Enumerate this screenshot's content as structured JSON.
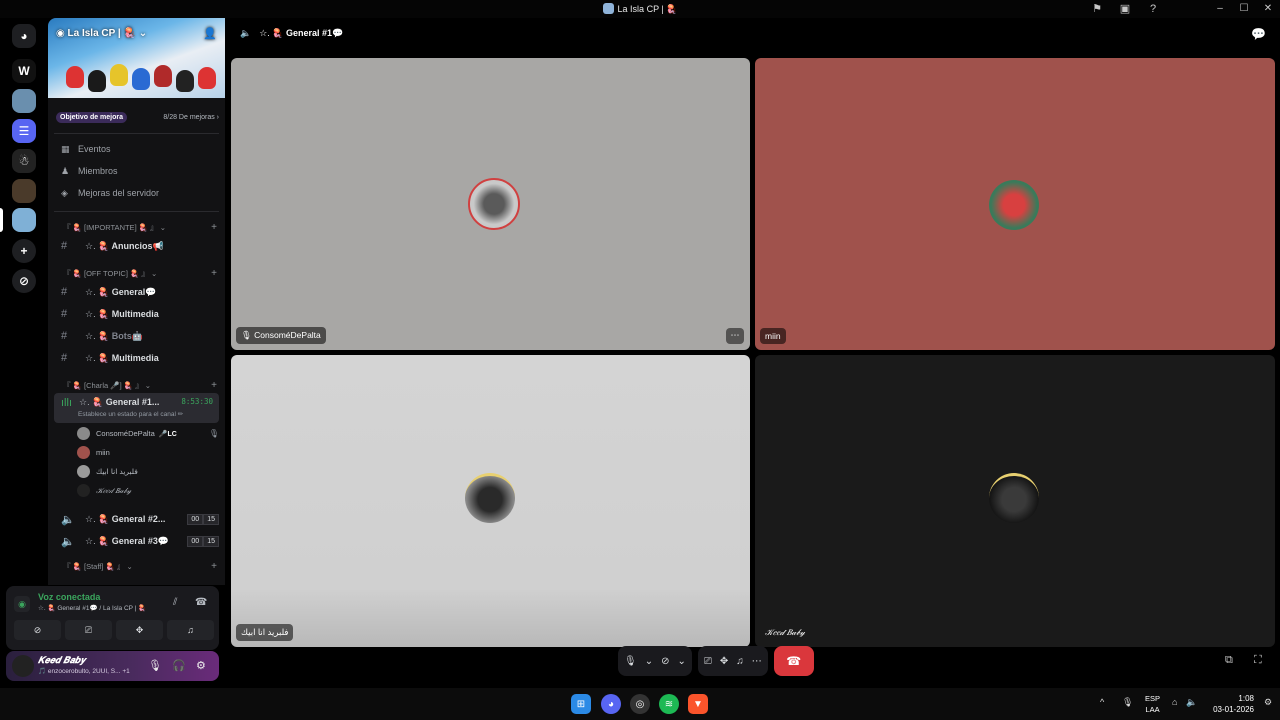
{
  "window": {
    "title": "La Isla CP | 🪼"
  },
  "server": {
    "name": "La Isla CP | 🪼",
    "boost_goal": "Objetivo de mejora",
    "boost_count": "8/28 De mejoras ›"
  },
  "nav": [
    {
      "label": "Eventos",
      "icon": "calendar-icon"
    },
    {
      "label": "Miembros",
      "icon": "members-icon"
    },
    {
      "label": "Mejoras del servidor",
      "icon": "boost-icon"
    }
  ],
  "categories": {
    "important": "『 🪼 [IMPORTANTE] 🪼 』",
    "offtopic": "『 🪼 [OFF TOPIC] 🪼 』",
    "charla": "『 🪼 [Charla 🎤] 🪼 』",
    "staff": "『 🪼 [Staff] 🪼 』"
  },
  "channels": {
    "anuncios": "🪼 Anuncios📢",
    "general": "🪼 General💬",
    "multimedia1": "🪼 Multimedia",
    "bots": "🪼 Bots🤖",
    "multimedia2": "🪼 Multimedia",
    "voice_active": "🪼 General #1...",
    "voice_active_prefix": "☆.",
    "voice_timer": "8:53:30",
    "voice_status": "Establece un estado para el canal ✏",
    "voice2": "🪼 General #2...",
    "voice2_prefix": "☆.",
    "voice2_count": [
      "00",
      "15"
    ],
    "voice3": "🪼 General #3💬",
    "voice3_prefix": "☆.",
    "voice3_count": [
      "00",
      "15"
    ]
  },
  "voice_users": [
    {
      "name": "ConsoméDePalta",
      "tag": "🎤LC"
    },
    {
      "name": "miin",
      "tag": ""
    },
    {
      "name": "فلبريد انا ابيك",
      "tag": ""
    },
    {
      "name": "𝒦𝑒𝑒𝒹 𝐵𝒶𝒷𝓎",
      "tag": ""
    }
  ],
  "voice_panel": {
    "status": "Voz conectada",
    "sub": "☆. 🪼 General #1💬 / La Isla CP | 🪼"
  },
  "user": {
    "name": "𝑲𝒆𝒆𝒅 𝑩𝒂𝒃𝒚",
    "status": "🎵 enzocerobulto, 2UUI, S... +1"
  },
  "header": {
    "prefix": "☆.",
    "channel": "🪼 General #1💬"
  },
  "tiles": [
    {
      "name": "🎙 ConsoméDePalta",
      "bg": "#a8a7a5"
    },
    {
      "name": "miin",
      "bg": "#a0524c"
    },
    {
      "name": "فلبريد انا ابيك",
      "bg": "#d4d4d4"
    },
    {
      "name": "𝒦𝑒𝑒𝒹 𝐵𝒶𝒷𝓎",
      "bg": "#1a1a1a"
    }
  ],
  "taskbar": {
    "lang_top": "ESP",
    "lang_bottom": "LAA",
    "time": "1:08",
    "date": "03-01-2026"
  },
  "colors": {
    "accent_green": "#3ba55d",
    "hangup_red": "#da373c",
    "discord_blurple": "#5865f2"
  }
}
